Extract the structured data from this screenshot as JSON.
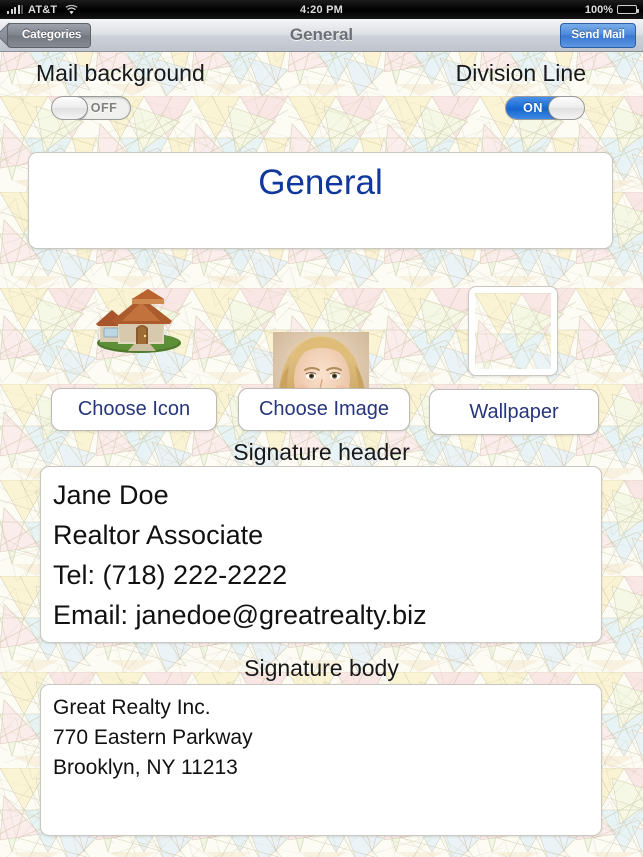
{
  "status_bar": {
    "signal_icon": "signal-bars-icon",
    "carrier": "AT&T",
    "wifi_icon": "wifi-icon",
    "time": "4:20 PM",
    "battery_percent": "100%",
    "battery_icon": "battery-full-icon"
  },
  "nav_bar": {
    "back_label": "Categories",
    "title": "General",
    "action_label": "Send Mail"
  },
  "settings": {
    "mail_background": {
      "label": "Mail background",
      "state_label": "OFF",
      "value": false
    },
    "division_line": {
      "label": "Division Line",
      "state_label": "ON",
      "value": true
    }
  },
  "title_box": {
    "text": "General",
    "color": "#10379b"
  },
  "media": {
    "icon_name": "house-icon",
    "photo_name": "portrait-photo",
    "wallpaper_thumb_name": "wallpaper-thumbnail"
  },
  "buttons": {
    "choose_icon": "Choose Icon",
    "choose_image": "Choose Image",
    "wallpaper": "Wallpaper"
  },
  "signature_header": {
    "label": "Signature header",
    "lines": [
      "Jane Doe",
      "Realtor Associate",
      "Tel: (718) 222-2222",
      "Email: janedoe@greatrealty.biz"
    ]
  },
  "signature_body": {
    "label": "Signature body",
    "lines": [
      "Great Realty Inc.",
      "770 Eastern Parkway",
      "Brooklyn, NY 11213"
    ]
  },
  "theme": {
    "accent_blue": "#3a76d0",
    "title_blue": "#10379b",
    "button_text_blue": "#27357a",
    "panel_white": "#ffffff"
  }
}
